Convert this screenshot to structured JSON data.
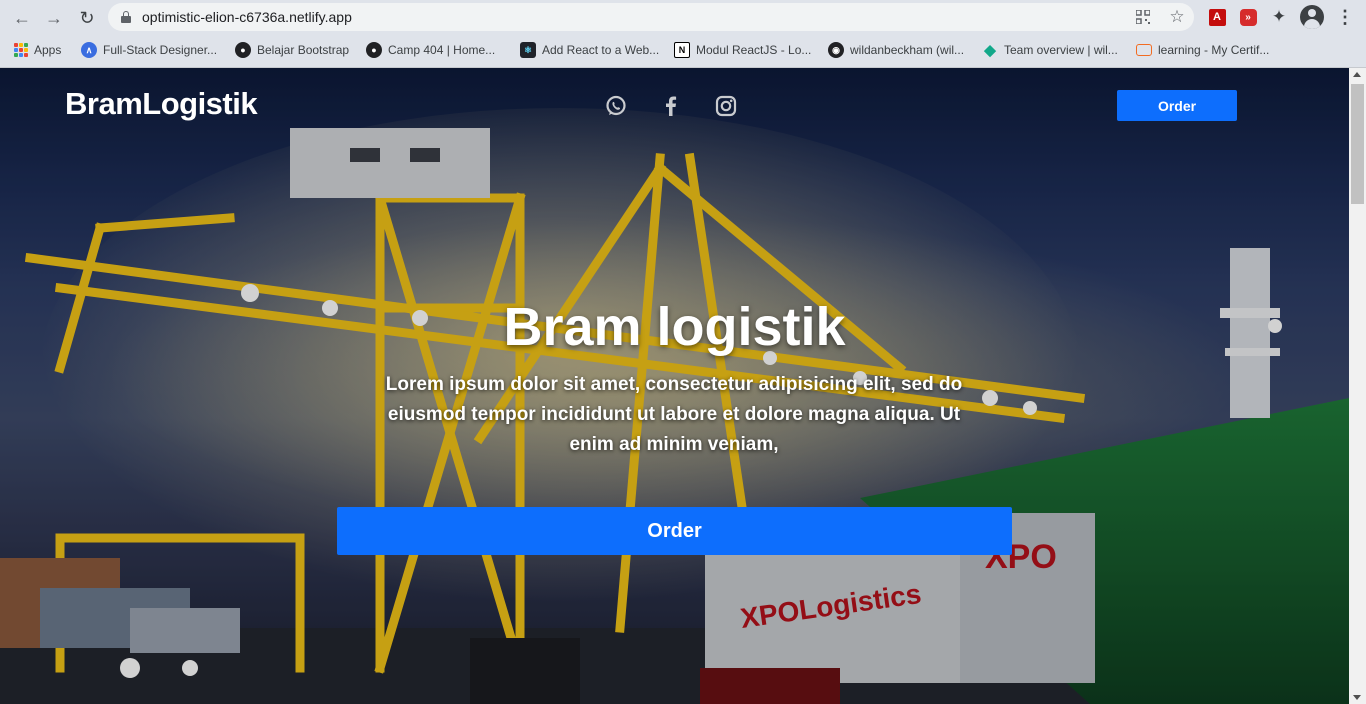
{
  "browser": {
    "url": "optimistic-elion-c6736a.netlify.app",
    "bookmarks": [
      {
        "label": "Apps",
        "icon": "apps-grid-icon"
      },
      {
        "label": "Full-Stack Designer...",
        "icon": "site-icon"
      },
      {
        "label": "Belajar Bootstrap",
        "icon": "globe-icon"
      },
      {
        "label": "Camp 404 | Home...",
        "icon": "globe-icon"
      },
      {
        "label": "Add React to a Web...",
        "icon": "react-icon"
      },
      {
        "label": "Modul ReactJS - Lo...",
        "icon": "notion-icon"
      },
      {
        "label": "wildanbeckham (wil...",
        "icon": "github-icon"
      },
      {
        "label": "Team overview | wil...",
        "icon": "diamond-icon"
      },
      {
        "label": "learning - My Certif...",
        "icon": "bracket-icon"
      }
    ]
  },
  "page": {
    "brand": "BramLogistik",
    "nav_order_label": "Order",
    "social": [
      "whatsapp-icon",
      "facebook-icon",
      "instagram-icon"
    ],
    "hero": {
      "title": "Bram logistik",
      "text": "Lorem ipsum dolor sit amet, consectetur adipisicing elit, sed do eiusmod tempor incididunt ut labore et dolore magna aliqua. Ut enim ad minim veniam,",
      "order_label": "Order"
    }
  },
  "colors": {
    "primary": "#0d6efd",
    "text": "#ffffff"
  }
}
